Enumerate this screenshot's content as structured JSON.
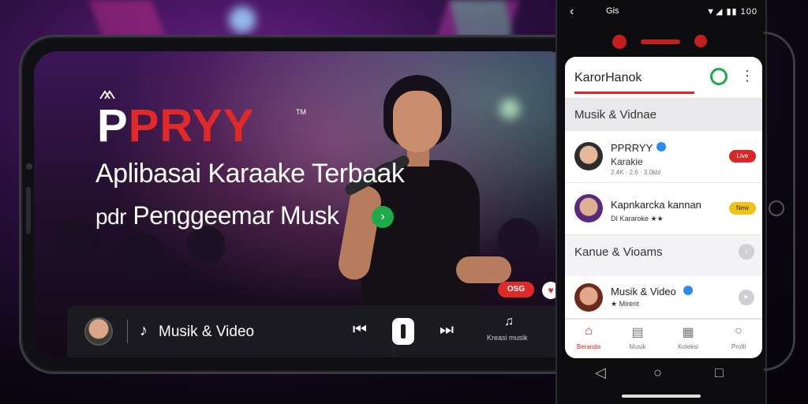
{
  "hero": {
    "brand_white": "P",
    "brand_red": "PRYY",
    "brand_tm": "TM",
    "tagline_line1": "Aplibasai Karaake Terbaak",
    "tagline_line2_small": "pdr",
    "tagline_line2": "Penggeemar Musk",
    "go_glyph": "›",
    "live_badge": "OSG",
    "heart_glyph": "♥"
  },
  "player": {
    "label": "Musik & Video",
    "note_glyph": "♪",
    "prev_glyph": "⏮",
    "next_glyph": "⏭",
    "more_glyph": "♫",
    "more_label": "Kreasi musik"
  },
  "status_bar": {
    "back_glyph": "‹",
    "app_label": "Gis",
    "icons": "▼◢ ▮▮ 100"
  },
  "app": {
    "title": "KarorHanok",
    "menu_glyph": "⋮",
    "sections": [
      {
        "title": "Musik & Vidnae"
      },
      {
        "title": "Kanue & Vioams"
      }
    ],
    "rows": [
      {
        "name": "PPRRYY",
        "sub": "Karakie",
        "meta": "2.4K · 2.6 · 3.0kbl",
        "pill": "Live"
      },
      {
        "name": "Kapnkarcka kannan",
        "sub": "DI Kararoke ★★",
        "meta": "",
        "pill": "New"
      },
      {
        "name": "Musik & Video",
        "sub": "★ Mirent",
        "meta": "",
        "pill": ""
      }
    ],
    "tabs": [
      {
        "icon": "⌂",
        "label": "Beranda"
      },
      {
        "icon": "▤",
        "label": "Musik"
      },
      {
        "icon": "▦",
        "label": "Koleksi"
      },
      {
        "icon": "○",
        "label": "Profil"
      }
    ]
  },
  "android_nav": {
    "back": "◁",
    "home": "○",
    "recent": "□"
  },
  "colors": {
    "accent_red": "#e02a2a",
    "accent_green": "#1faa4a",
    "verified_blue": "#2f8be8"
  }
}
